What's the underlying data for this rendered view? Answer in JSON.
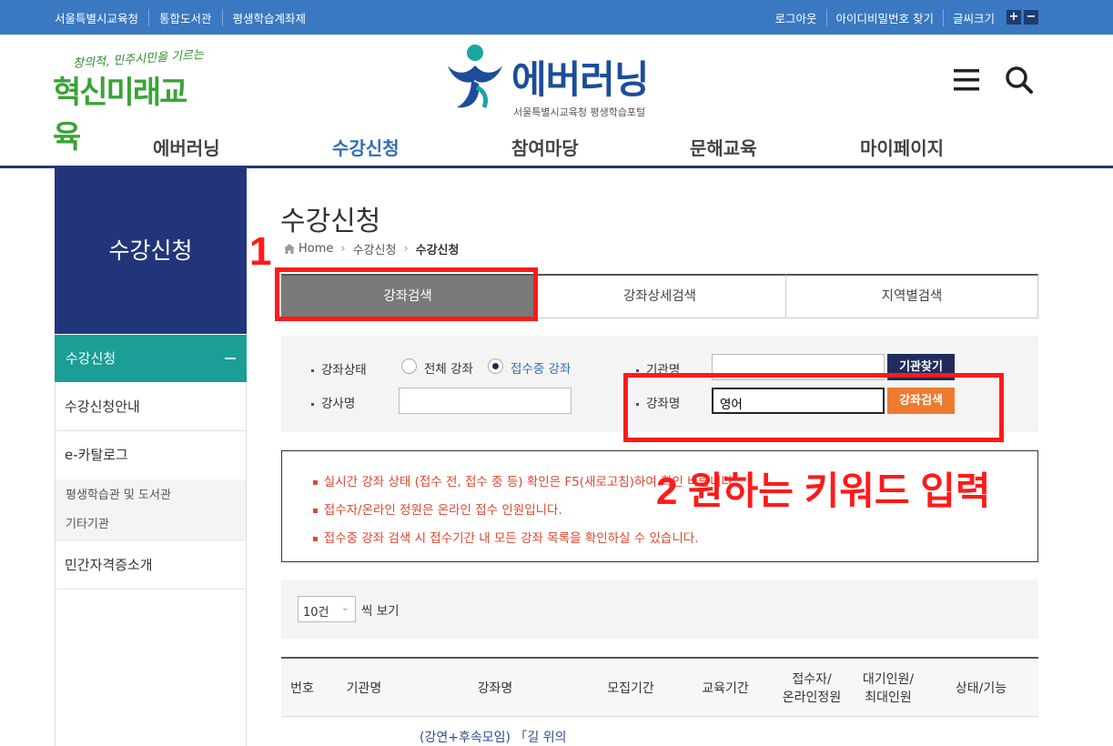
{
  "topbar": {
    "links_left": [
      "서울특별시교육청",
      "통합도서관",
      "평생학습계좌제"
    ],
    "links_right": [
      "로그아웃",
      "아이디비밀번호 찾기",
      "글씨크기"
    ],
    "font_plus": "+",
    "font_minus": "−"
  },
  "header": {
    "slogan_line1": "창의적, 민주시민을 기르는",
    "slogan_line2": "혁신미래교육",
    "logo_title": "에버러닝",
    "logo_subtitle": "서울특별시교육청 평생학습포털"
  },
  "nav": [
    "에버러닝",
    "수강신청",
    "참여마당",
    "문해교육",
    "마이페이지"
  ],
  "sidebar": {
    "title": "수강신청",
    "current": "수강신청",
    "items": [
      "수강신청안내",
      "e-카탈로그",
      "민간자격증소개"
    ],
    "subitems": [
      "평생학습관 및 도서관",
      "기타기관"
    ]
  },
  "page": {
    "title": "수강신청",
    "breadcrumb": [
      "Home",
      "수강신청",
      "수강신청"
    ]
  },
  "tabs": [
    "강좌검색",
    "강좌상세검색",
    "지역별검색"
  ],
  "search": {
    "status_label": "강좌상태",
    "radio_all": "전체 강좌",
    "radio_open": "접수중 강좌",
    "org_label": "기관명",
    "org_value": "",
    "org_button": "기관찾기",
    "teacher_label": "강사명",
    "teacher_value": "",
    "course_label": "강좌명",
    "course_value": "영어",
    "course_button": "강좌검색"
  },
  "notices": [
    "실시간 강좌 상태 (접수 전, 접수 중 등) 확인은 F5(새로고침)하여 확인 바랍니다.",
    "접수자/온라인 정원은 온라인 접수 인원입니다.",
    "접수중 강좌 검색 시 접수기간 내 모든 강좌 목록을 확인하실 수 있습니다."
  ],
  "rows": {
    "select": "10건",
    "suffix": "씩 보기"
  },
  "table": {
    "headers": [
      "번호",
      "기관명",
      "강좌명",
      "모집기간",
      "교육기간",
      "접수자/\n온라인정원",
      "대기인원/\n최대인원",
      "상태/기능"
    ],
    "first_row_text": "(강연+후속모임) 「길 위의"
  },
  "annotations": {
    "step1": "1",
    "step2": "2 원하는 키워드 입력",
    "color": "#ff1a1a"
  },
  "colors": {
    "topbar": "#3a78c2",
    "sidebar_title": "#23357a",
    "sidebar_active": "#1a9e95",
    "org_button": "#1f2c5c",
    "search_button": "#ee7a31",
    "notice_text": "#e0452e"
  }
}
